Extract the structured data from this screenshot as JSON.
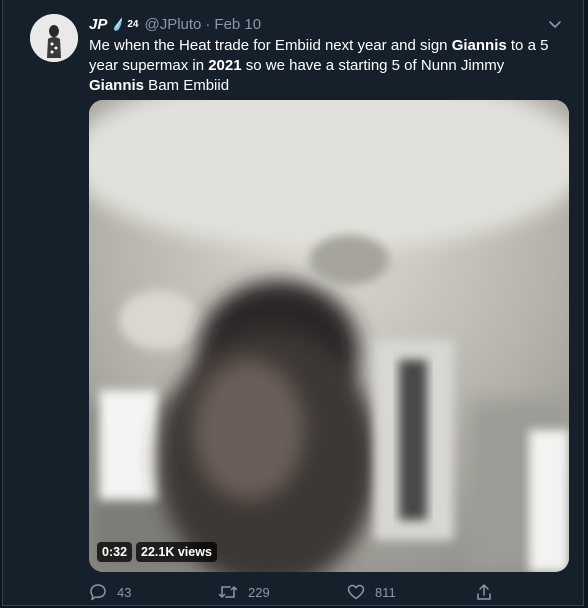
{
  "tweet": {
    "display_name": "JP",
    "badge_icon": "water-drop-icon",
    "badge_number": "24",
    "handle": "@JPluto",
    "separator": "·",
    "date": "Feb 10",
    "text_parts": [
      {
        "t": "Me when the Heat trade for Embiid next year and sign ",
        "bold": false
      },
      {
        "t": "Giannis",
        "bold": true
      },
      {
        "t": " to a 5 year supermax in ",
        "bold": false
      },
      {
        "t": "2021",
        "bold": true
      },
      {
        "t": " so we have a starting 5 of Nunn Jimmy ",
        "bold": false
      },
      {
        "t": "Giannis",
        "bold": true
      },
      {
        "t": " Bam Embiid",
        "bold": false
      }
    ]
  },
  "video": {
    "duration": "0:32",
    "views": "22.1K views"
  },
  "actions": {
    "replies": "43",
    "retweets": "229",
    "likes": "811"
  },
  "colors": {
    "background": "#15202b",
    "muted": "#8899a6",
    "text": "#ffffff"
  }
}
